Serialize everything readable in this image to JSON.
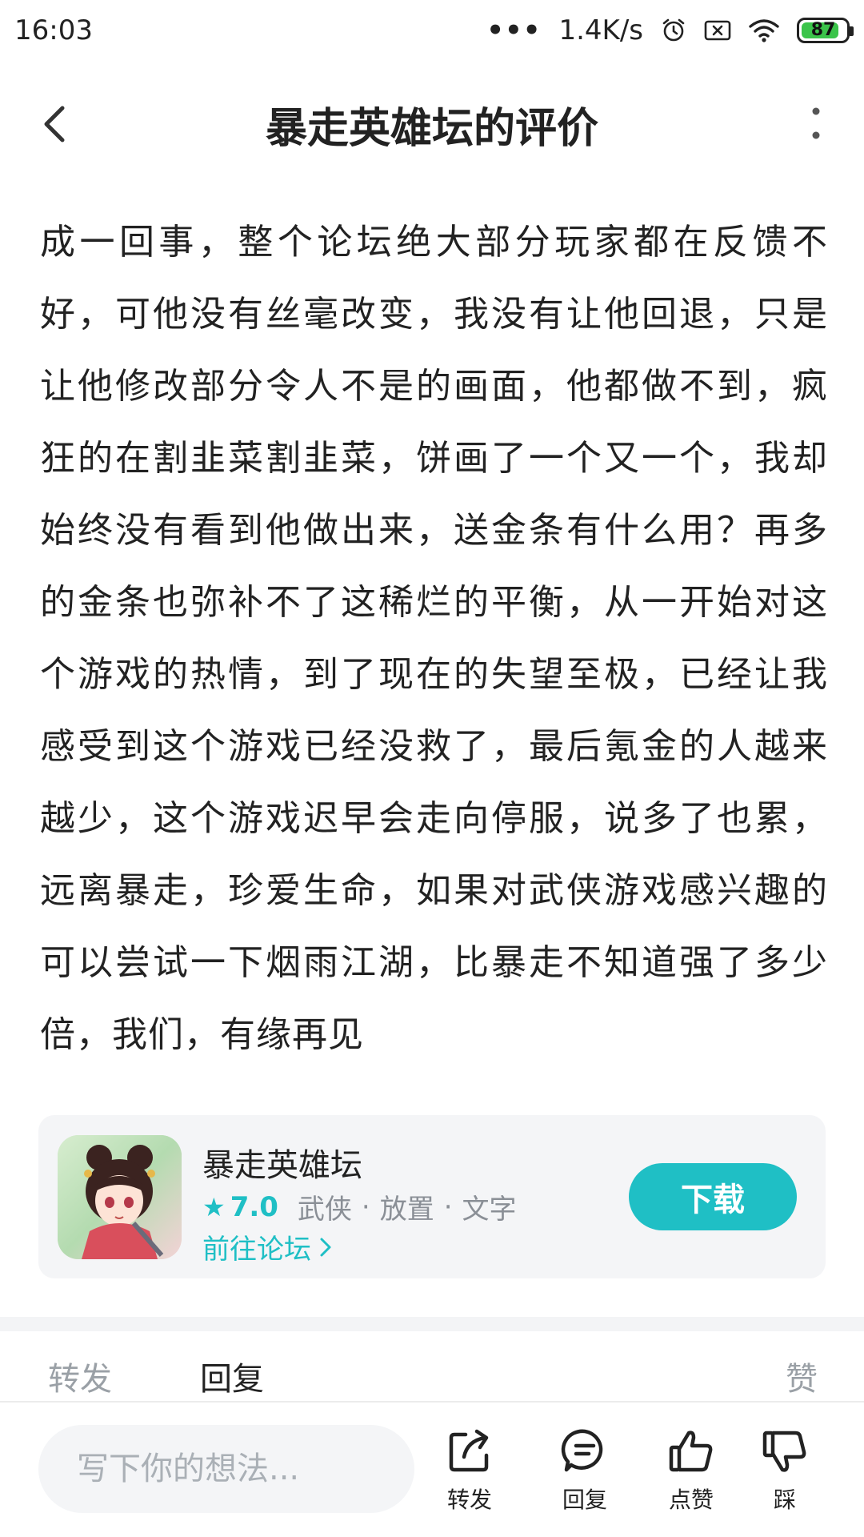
{
  "status_bar": {
    "time": "16:03",
    "network_speed": "1.4K/s",
    "battery": "87",
    "battery_level_percent": 87,
    "icons": [
      "more-dots-icon",
      "alarm-icon",
      "sim-off-icon",
      "wifi-icon",
      "battery-icon"
    ]
  },
  "nav": {
    "title": "暴走英雄坛的评价",
    "back_icon": "chevron-left-icon",
    "more_icon": "more-vertical-icon"
  },
  "review": {
    "text": "成一回事，整个论坛绝大部分玩家都在反馈不好，可他没有丝毫改变，我没有让他回退，只是让他修改部分令人不是的画面，他都做不到，疯狂的在割韭菜割韭菜，饼画了一个又一个，我却始终没有看到他做出来，送金条有什么用？再多的金条也弥补不了这稀烂的平衡，从一开始对这个游戏的热情，到了现在的失望至极，已经让我感受到这个游戏已经没救了，最后氪金的人越来越少，这个游戏迟早会走向停服，说多了也累，远离暴走，珍爱生命，如果对武侠游戏感兴趣的可以尝试一下烟雨江湖，比暴走不知道强了多少倍，我们，有缘再见"
  },
  "app_card": {
    "name": "暴走英雄坛",
    "rating": "7.0",
    "tags": [
      "武侠",
      "放置",
      "文字"
    ],
    "tag_separator": "·",
    "forum_link": "前往论坛",
    "download_label": "下载",
    "accent_color": "#1fbfc5"
  },
  "tabs": {
    "forward": "转发",
    "reply": "回复",
    "like": "赞"
  },
  "bottom_bar": {
    "input_placeholder": "写下你的想法...",
    "share_label": "转发",
    "reply_label": "回复",
    "like_label": "点赞",
    "dislike_label": "踩"
  }
}
